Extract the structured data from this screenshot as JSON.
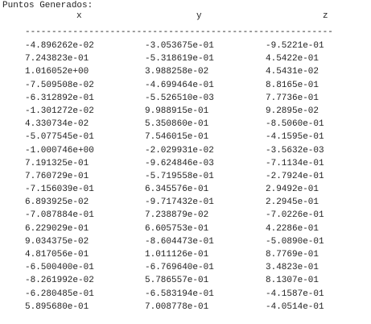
{
  "console": {
    "title": "Puntos Generados:",
    "headers": {
      "x": "x",
      "y": "y",
      "z": "z"
    },
    "separator": "----------------------------------------------------------",
    "rows": [
      {
        "x": "-4.896262e-02",
        "y": "-3.053675e-01",
        "z": "-9.5221e-01"
      },
      {
        "x": "7.243823e-01",
        "y": "-5.318619e-01",
        "z": "4.5422e-01"
      },
      {
        "x": "1.016052e+00",
        "y": "3.988258e-02",
        "z": "4.5431e-02"
      },
      {
        "x": "-7.509508e-02",
        "y": "-4.699464e-01",
        "z": "8.8165e-01"
      },
      {
        "x": "-6.312892e-01",
        "y": "-5.526510e-03",
        "z": "7.7736e-01"
      },
      {
        "x": "-1.301272e-02",
        "y": "9.988915e-01",
        "z": "9.2895e-02"
      },
      {
        "x": "4.330734e-02",
        "y": "5.350860e-01",
        "z": "-8.5060e-01"
      },
      {
        "x": "-5.077545e-01",
        "y": "7.546015e-01",
        "z": "-4.1595e-01"
      },
      {
        "x": "-1.000746e+00",
        "y": "-2.029931e-02",
        "z": "-3.5632e-03"
      },
      {
        "x": "7.191325e-01",
        "y": "-9.624846e-03",
        "z": "-7.1134e-01"
      },
      {
        "x": "7.760729e-01",
        "y": "-5.719558e-01",
        "z": "-2.7924e-01"
      },
      {
        "x": "-7.156039e-01",
        "y": "6.345576e-01",
        "z": "2.9492e-01"
      },
      {
        "x": "6.893925e-02",
        "y": "-9.717432e-01",
        "z": "2.2945e-01"
      },
      {
        "x": "-7.087884e-01",
        "y": "7.238879e-02",
        "z": "-7.0226e-01"
      },
      {
        "x": "6.229029e-01",
        "y": "6.605753e-01",
        "z": "4.2286e-01"
      },
      {
        "x": "9.034375e-02",
        "y": "-8.604473e-01",
        "z": "-5.0890e-01"
      },
      {
        "x": "4.817056e-01",
        "y": "1.011126e-01",
        "z": "8.7769e-01"
      },
      {
        "x": "-6.500400e-01",
        "y": "-6.769640e-01",
        "z": "3.4823e-01"
      },
      {
        "x": "-8.261992e-02",
        "y": "5.786557e-01",
        "z": "8.1307e-01"
      },
      {
        "x": "-6.280485e-01",
        "y": "-6.583194e-01",
        "z": "-4.1587e-01"
      },
      {
        "x": "5.895680e-01",
        "y": "7.008778e-01",
        "z": "-4.0514e-01"
      }
    ]
  }
}
